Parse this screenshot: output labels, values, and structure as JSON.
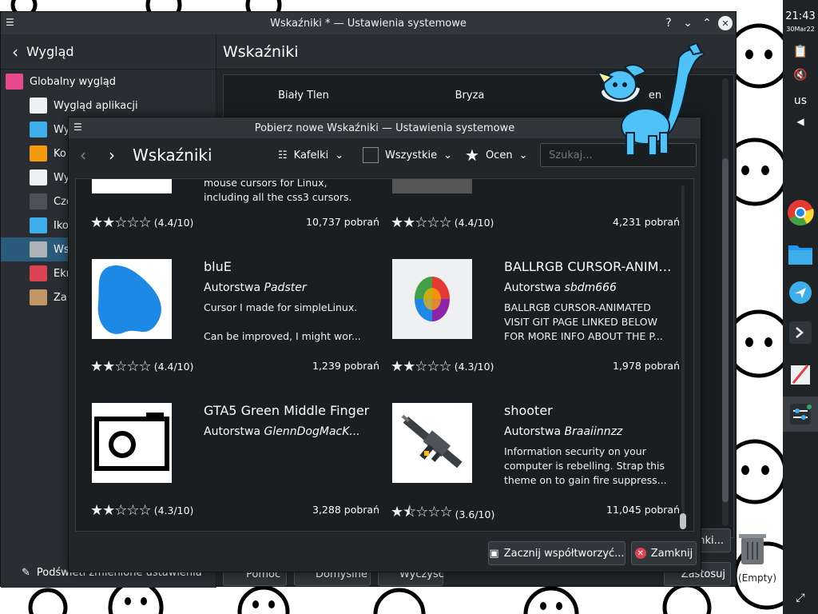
{
  "main_window": {
    "title": "Wskaźniki * — Ustawienia systemowe",
    "help_glyph": "?",
    "minimize_glyph": "⌄",
    "maximize_glyph": "⌃",
    "close_glyph": "✕",
    "sidebar": {
      "back_label": "Wygląd",
      "items": [
        {
          "label": "Globalny wygląd",
          "indent": false,
          "color": "#e64a8c"
        },
        {
          "label": "Wygląd aplikacji",
          "indent": true,
          "color": "#eff0f1"
        },
        {
          "label": "Wy",
          "indent": true,
          "color": "#3daee9"
        },
        {
          "label": "Ko",
          "indent": true,
          "color": "#f39c12"
        },
        {
          "label": "Wy",
          "indent": true,
          "color": "#eff0f1"
        },
        {
          "label": "Czc",
          "indent": true,
          "color": "#4d5359"
        },
        {
          "label": "Iko",
          "indent": true,
          "color": "#3daee9"
        },
        {
          "label": "Ws",
          "indent": true,
          "color": "#b0b4b8",
          "selected": true
        },
        {
          "label": "Ekr",
          "indent": true,
          "color": "#da4453"
        },
        {
          "label": "Zan",
          "indent": true,
          "color": "#c29567"
        }
      ]
    },
    "page_title": "Wskaźniki",
    "theme_tabs": [
      "Biały Tlen",
      "Bryza",
      "en"
    ],
    "bottom": {
      "highlight_label": "Podświetl zmienione ustawienia",
      "help_btn": "Pomoc",
      "defaults_btn": "Domyślne",
      "reset_btn": "Wyczyść",
      "get_new_btn": "nki...",
      "apply_btn": "Zastosuj",
      "trash_label": "(Empty)"
    }
  },
  "dialog": {
    "title": "Pobierz nowe Wskaźniki — Ustawienia systemowe",
    "heading": "Wskaźniki",
    "view_mode": "Kafelki",
    "filter": "Wszystkie",
    "sort": "Ocen",
    "search_placeholder": "Szukaj...",
    "contribute_btn": "Zacznij współtworzyć...",
    "close_btn": "Zamknij",
    "top_cards": [
      {
        "desc": [
          "mouse cursors for Linux,",
          "including all the css3 cursors."
        ],
        "rating": "(4.4/10)",
        "downloads": "10,737 pobrań",
        "stars_full": 2,
        "stars_half": 0
      },
      {
        "desc": [],
        "rating": "(4.4/10)",
        "downloads": "4,231 pobrań",
        "stars_full": 2,
        "stars_half": 0
      }
    ],
    "cards": [
      {
        "title": "bluE",
        "author_prefix": "Autorstwa",
        "author": "Padster",
        "desc": [
          "Cursor I made for simpleLinux.",
          "",
          "Can be improved, I might wor..."
        ],
        "rating": "(4.4/10)",
        "downloads": "1,239 pobrań",
        "stars_full": 2,
        "stars_half": 0,
        "thumb": "blue-blob"
      },
      {
        "title": "BALLRGB CURSOR-ANIMATED",
        "author_prefix": "Autorstwa",
        "author": "sbdm666",
        "desc": [
          "BALLRGB CURSOR-ANIMATED",
          "VISIT GIT PAGE LINKED BELOW",
          "FOR MORE INFO ABOUT THE P..."
        ],
        "rating": "(4.3/10)",
        "downloads": "1,978 pobrań",
        "stars_full": 2,
        "stars_half": 0,
        "thumb": "rgb-ball"
      },
      {
        "title": "GTA5 Green Middle Finger",
        "author_prefix": "Autorstwa",
        "author": "GlennDogMacK...",
        "desc": [],
        "rating": "(4.3/10)",
        "downloads": "3,288 pobrań",
        "stars_full": 2,
        "stars_half": 0,
        "thumb": "camera"
      },
      {
        "title": "shooter",
        "author_prefix": "Autorstwa",
        "author": "Braaiinnzz",
        "desc": [
          "Information security on your",
          "computer is rebelling. Strap this",
          "theme on to gain fire suppress..."
        ],
        "rating": "(3.6/10)",
        "downloads": "11,045 pobrań",
        "stars_full": 1,
        "stars_half": 1,
        "thumb": "rifle"
      }
    ]
  },
  "panel": {
    "time": "21:43",
    "date": "30Mar22",
    "keyboard_layout": "us"
  }
}
